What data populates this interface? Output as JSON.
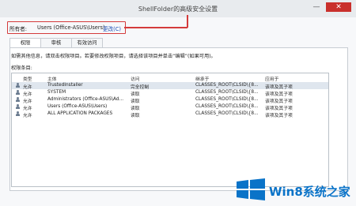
{
  "window": {
    "title": "ShellFolder的高级安全设置",
    "minimize_glyph": "—",
    "close_glyph": "✕"
  },
  "owner": {
    "label": "所有者:",
    "value": "Users (Office-ASUS\\Users)",
    "change_link": "更改(C)"
  },
  "tabs": [
    {
      "label": "权限"
    },
    {
      "label": "审核"
    },
    {
      "label": "有效访问"
    }
  ],
  "info_text": "如需其他信息，请双击权限项目。若要修改权限项目，请选择该项目并单击“编辑”(如果可用)。",
  "entries_label": "权限条目:",
  "table": {
    "headers": [
      "类型",
      "主体",
      "访问",
      "继承于",
      "应用于"
    ],
    "rows": [
      {
        "type": "允许",
        "principal": "TrustedInstaller",
        "access": "完全控制",
        "inherited": "CLASSES_ROOT\\CLSID\\{8...",
        "applies": "该项及其子项"
      },
      {
        "type": "允许",
        "principal": "SYSTEM",
        "access": "读取",
        "inherited": "CLASSES_ROOT\\CLSID\\{8...",
        "applies": "该项及其子项"
      },
      {
        "type": "允许",
        "principal": "Administrators (Office-ASUS\\Ad...",
        "access": "读取",
        "inherited": "CLASSES_ROOT\\CLSID\\{8...",
        "applies": "该项及其子项"
      },
      {
        "type": "允许",
        "principal": "Users (Office-ASUS\\Users)",
        "access": "读取",
        "inherited": "CLASSES_ROOT\\CLSID\\{8...",
        "applies": "该项及其子项"
      },
      {
        "type": "允许",
        "principal": "ALL APPLICATION PACKAGES",
        "access": "读取",
        "inherited": "CLASSES_ROOT\\CLSID\\{8...",
        "applies": "该项及其子项"
      }
    ]
  },
  "watermark": {
    "text": "Win8系统之家"
  },
  "colors": {
    "highlight_red": "#d43b3b",
    "link_blue": "#1f4fb5",
    "logo_blue": "#0a73c8"
  }
}
